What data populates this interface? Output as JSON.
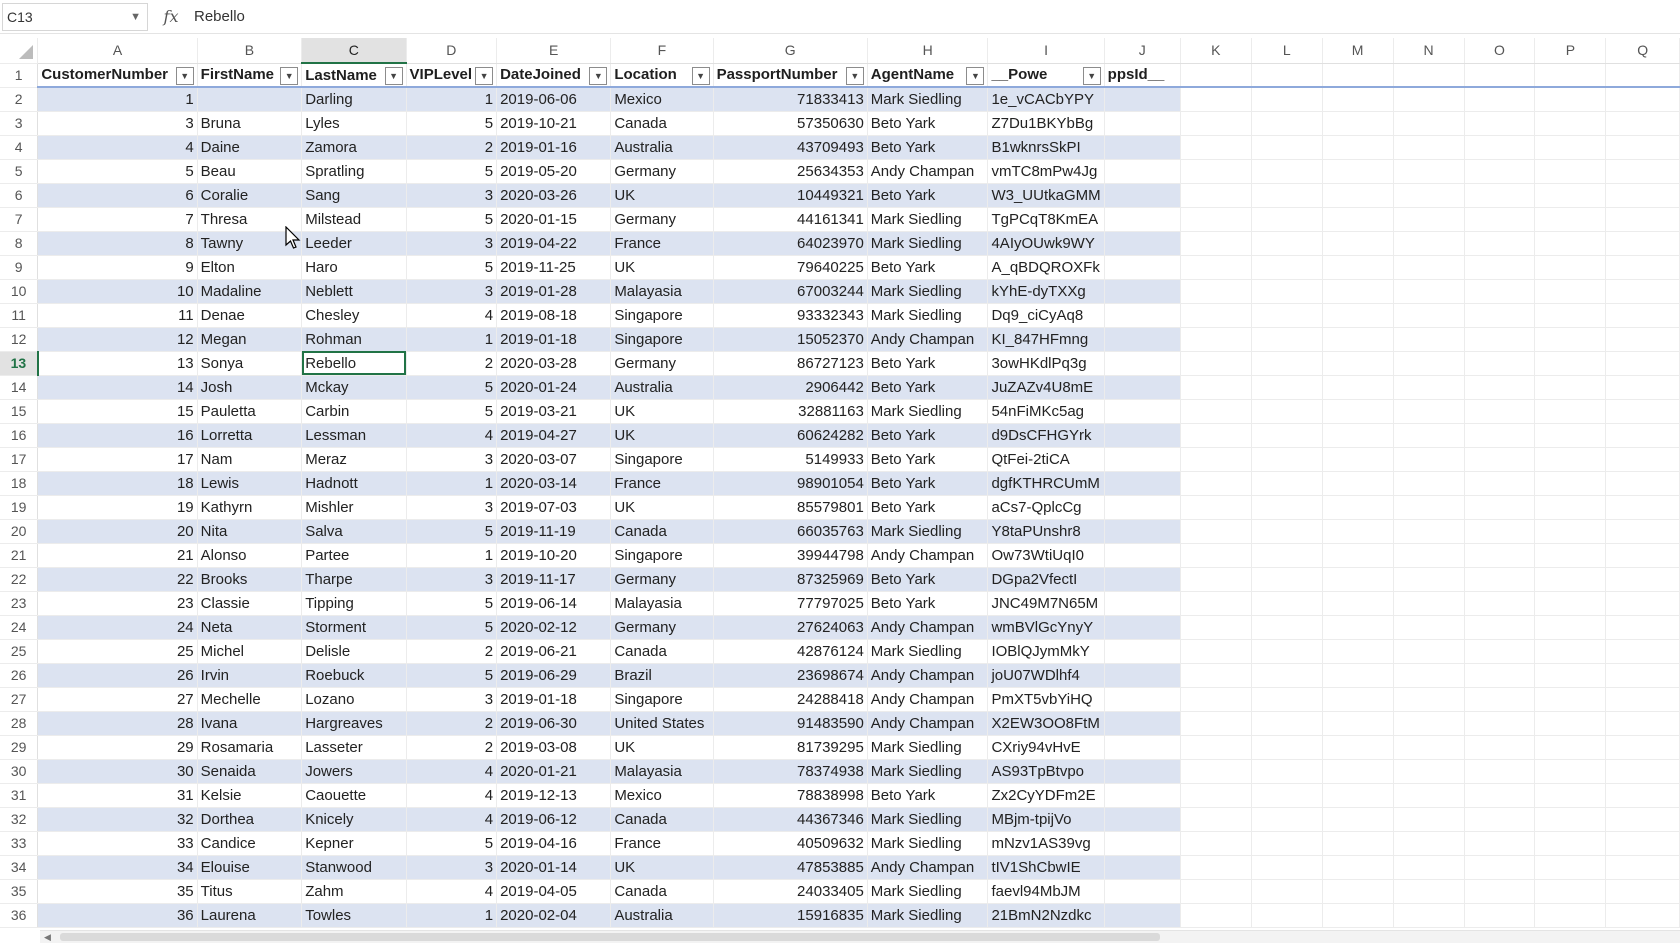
{
  "name_box": {
    "value": "C13",
    "icon": "chevron-down-icon"
  },
  "formula_bar": {
    "fx_label": "fx",
    "value": "Rebello"
  },
  "columns": [
    "A",
    "B",
    "C",
    "D",
    "E",
    "F",
    "G",
    "H",
    "I",
    "J",
    "K",
    "L",
    "M",
    "N",
    "O",
    "P",
    "Q"
  ],
  "headers": [
    "CustomerNumber",
    "FirstName",
    "LastName",
    "VIPLevel",
    "DateJoined",
    "Location",
    "PassportNumber",
    "AgentName",
    "__Powe",
    "ppsId__"
  ],
  "rows": [
    [
      "1",
      "",
      "Darling",
      "1",
      "2019-06-06",
      "Mexico",
      "71833413",
      "Mark Siedling",
      "1e_vCACbYPY"
    ],
    [
      "3",
      "Bruna",
      "Lyles",
      "5",
      "2019-10-21",
      "Canada",
      "57350630",
      "Beto Yark",
      "Z7Du1BKYbBg"
    ],
    [
      "4",
      "Daine",
      "Zamora",
      "2",
      "2019-01-16",
      "Australia",
      "43709493",
      "Beto Yark",
      "B1wknrsSkPI"
    ],
    [
      "5",
      "Beau",
      "Spratling",
      "5",
      "2019-05-20",
      "Germany",
      "25634353",
      "Andy Champan",
      "vmTC8mPw4Jg"
    ],
    [
      "6",
      "Coralie",
      "Sang",
      "3",
      "2020-03-26",
      "UK",
      "10449321",
      "Beto Yark",
      "W3_UUtkaGMM"
    ],
    [
      "7",
      "Thresa",
      "Milstead",
      "5",
      "2020-01-15",
      "Germany",
      "44161341",
      "Mark Siedling",
      "TgPCqT8KmEA"
    ],
    [
      "8",
      "Tawny",
      "Leeder",
      "3",
      "2019-04-22",
      "France",
      "64023970",
      "Mark Siedling",
      "4AIyOUwk9WY"
    ],
    [
      "9",
      "Elton",
      "Haro",
      "5",
      "2019-11-25",
      "UK",
      "79640225",
      "Beto Yark",
      "A_qBDQROXFk"
    ],
    [
      "10",
      "Madaline",
      "Neblett",
      "3",
      "2019-01-28",
      "Malayasia",
      "67003244",
      "Mark Siedling",
      "kYhE-dyTXXg"
    ],
    [
      "11",
      "Denae",
      "Chesley",
      "4",
      "2019-08-18",
      "Singapore",
      "93332343",
      "Mark Siedling",
      "Dq9_ciCyAq8"
    ],
    [
      "12",
      "Megan",
      "Rohman",
      "1",
      "2019-01-18",
      "Singapore",
      "15052370",
      "Andy Champan",
      "KI_847HFmng"
    ],
    [
      "13",
      "Sonya",
      "Rebello",
      "2",
      "2020-03-28",
      "Germany",
      "86727123",
      "Beto Yark",
      "3owHKdlPq3g"
    ],
    [
      "14",
      "Josh",
      "Mckay",
      "5",
      "2020-01-24",
      "Australia",
      "2906442",
      "Beto Yark",
      "JuZAZv4U8mE"
    ],
    [
      "15",
      "Pauletta",
      "Carbin",
      "5",
      "2019-03-21",
      "UK",
      "32881163",
      "Mark Siedling",
      "54nFiMKc5ag"
    ],
    [
      "16",
      "Lorretta",
      "Lessman",
      "4",
      "2019-04-27",
      "UK",
      "60624282",
      "Beto Yark",
      "d9DsCFHGYrk"
    ],
    [
      "17",
      "Nam",
      "Meraz",
      "3",
      "2020-03-07",
      "Singapore",
      "5149933",
      "Beto Yark",
      "QtFei-2tiCA"
    ],
    [
      "18",
      "Lewis",
      "Hadnott",
      "1",
      "2020-03-14",
      "France",
      "98901054",
      "Beto Yark",
      "dgfKTHRCUmM"
    ],
    [
      "19",
      "Kathyrn",
      "Mishler",
      "3",
      "2019-07-03",
      "UK",
      "85579801",
      "Beto Yark",
      "aCs7-QplcCg"
    ],
    [
      "20",
      "Nita",
      "Salva",
      "5",
      "2019-11-19",
      "Canada",
      "66035763",
      "Mark Siedling",
      "Y8taPUnshr8"
    ],
    [
      "21",
      "Alonso",
      "Partee",
      "1",
      "2019-10-20",
      "Singapore",
      "39944798",
      "Andy Champan",
      "Ow73WtiUqI0"
    ],
    [
      "22",
      "Brooks",
      "Tharpe",
      "3",
      "2019-11-17",
      "Germany",
      "87325969",
      "Beto Yark",
      "DGpa2VfectI"
    ],
    [
      "23",
      "Classie",
      "Tipping",
      "5",
      "2019-06-14",
      "Malayasia",
      "77797025",
      "Beto Yark",
      "JNC49M7N65M"
    ],
    [
      "24",
      "Neta",
      "Storment",
      "5",
      "2020-02-12",
      "Germany",
      "27624063",
      "Andy Champan",
      "wmBVlGcYnyY"
    ],
    [
      "25",
      "Michel",
      "Delisle",
      "2",
      "2019-06-21",
      "Canada",
      "42876124",
      "Mark Siedling",
      "IOBlQJymMkY"
    ],
    [
      "26",
      "Irvin",
      "Roebuck",
      "5",
      "2019-06-29",
      "Brazil",
      "23698674",
      "Andy Champan",
      "joU07WDlhf4"
    ],
    [
      "27",
      "Mechelle",
      "Lozano",
      "3",
      "2019-01-18",
      "Singapore",
      "24288418",
      "Andy Champan",
      "PmXT5vbYiHQ"
    ],
    [
      "28",
      "Ivana",
      "Hargreaves",
      "2",
      "2019-06-30",
      "United States",
      "91483590",
      "Andy Champan",
      "X2EW3OO8FtM"
    ],
    [
      "29",
      "Rosamaria",
      "Lasseter",
      "2",
      "2019-03-08",
      "UK",
      "81739295",
      "Mark Siedling",
      "CXriy94vHvE"
    ],
    [
      "30",
      "Senaida",
      "Jowers",
      "4",
      "2020-01-21",
      "Malayasia",
      "78374938",
      "Mark Siedling",
      "AS93TpBtvpo"
    ],
    [
      "31",
      "Kelsie",
      "Caouette",
      "4",
      "2019-12-13",
      "Mexico",
      "78838998",
      "Beto Yark",
      "Zx2CyYDFm2E"
    ],
    [
      "32",
      "Dorthea",
      "Knicely",
      "4",
      "2019-06-12",
      "Canada",
      "44367346",
      "Mark Siedling",
      "MBjm-tpijVo"
    ],
    [
      "33",
      "Candice",
      "Kepner",
      "5",
      "2019-04-16",
      "France",
      "40509632",
      "Mark Siedling",
      "mNzv1AS39vg"
    ],
    [
      "34",
      "Elouise",
      "Stanwood",
      "3",
      "2020-01-14",
      "UK",
      "47853885",
      "Andy Champan",
      "tIV1ShCbwIE"
    ],
    [
      "35",
      "Titus",
      "Zahm",
      "4",
      "2019-04-05",
      "Canada",
      "24033405",
      "Mark Siedling",
      "faevl94MbJM"
    ],
    [
      "36",
      "Laurena",
      "Towles",
      "1",
      "2020-02-04",
      "Australia",
      "15916835",
      "Mark Siedling",
      "21BmN2Nzdkc"
    ]
  ],
  "selection": {
    "active_column": "C",
    "active_row": 13
  },
  "colors": {
    "band": "#dce3f1",
    "accent": "#217346",
    "header_border": "#8ea9db"
  }
}
